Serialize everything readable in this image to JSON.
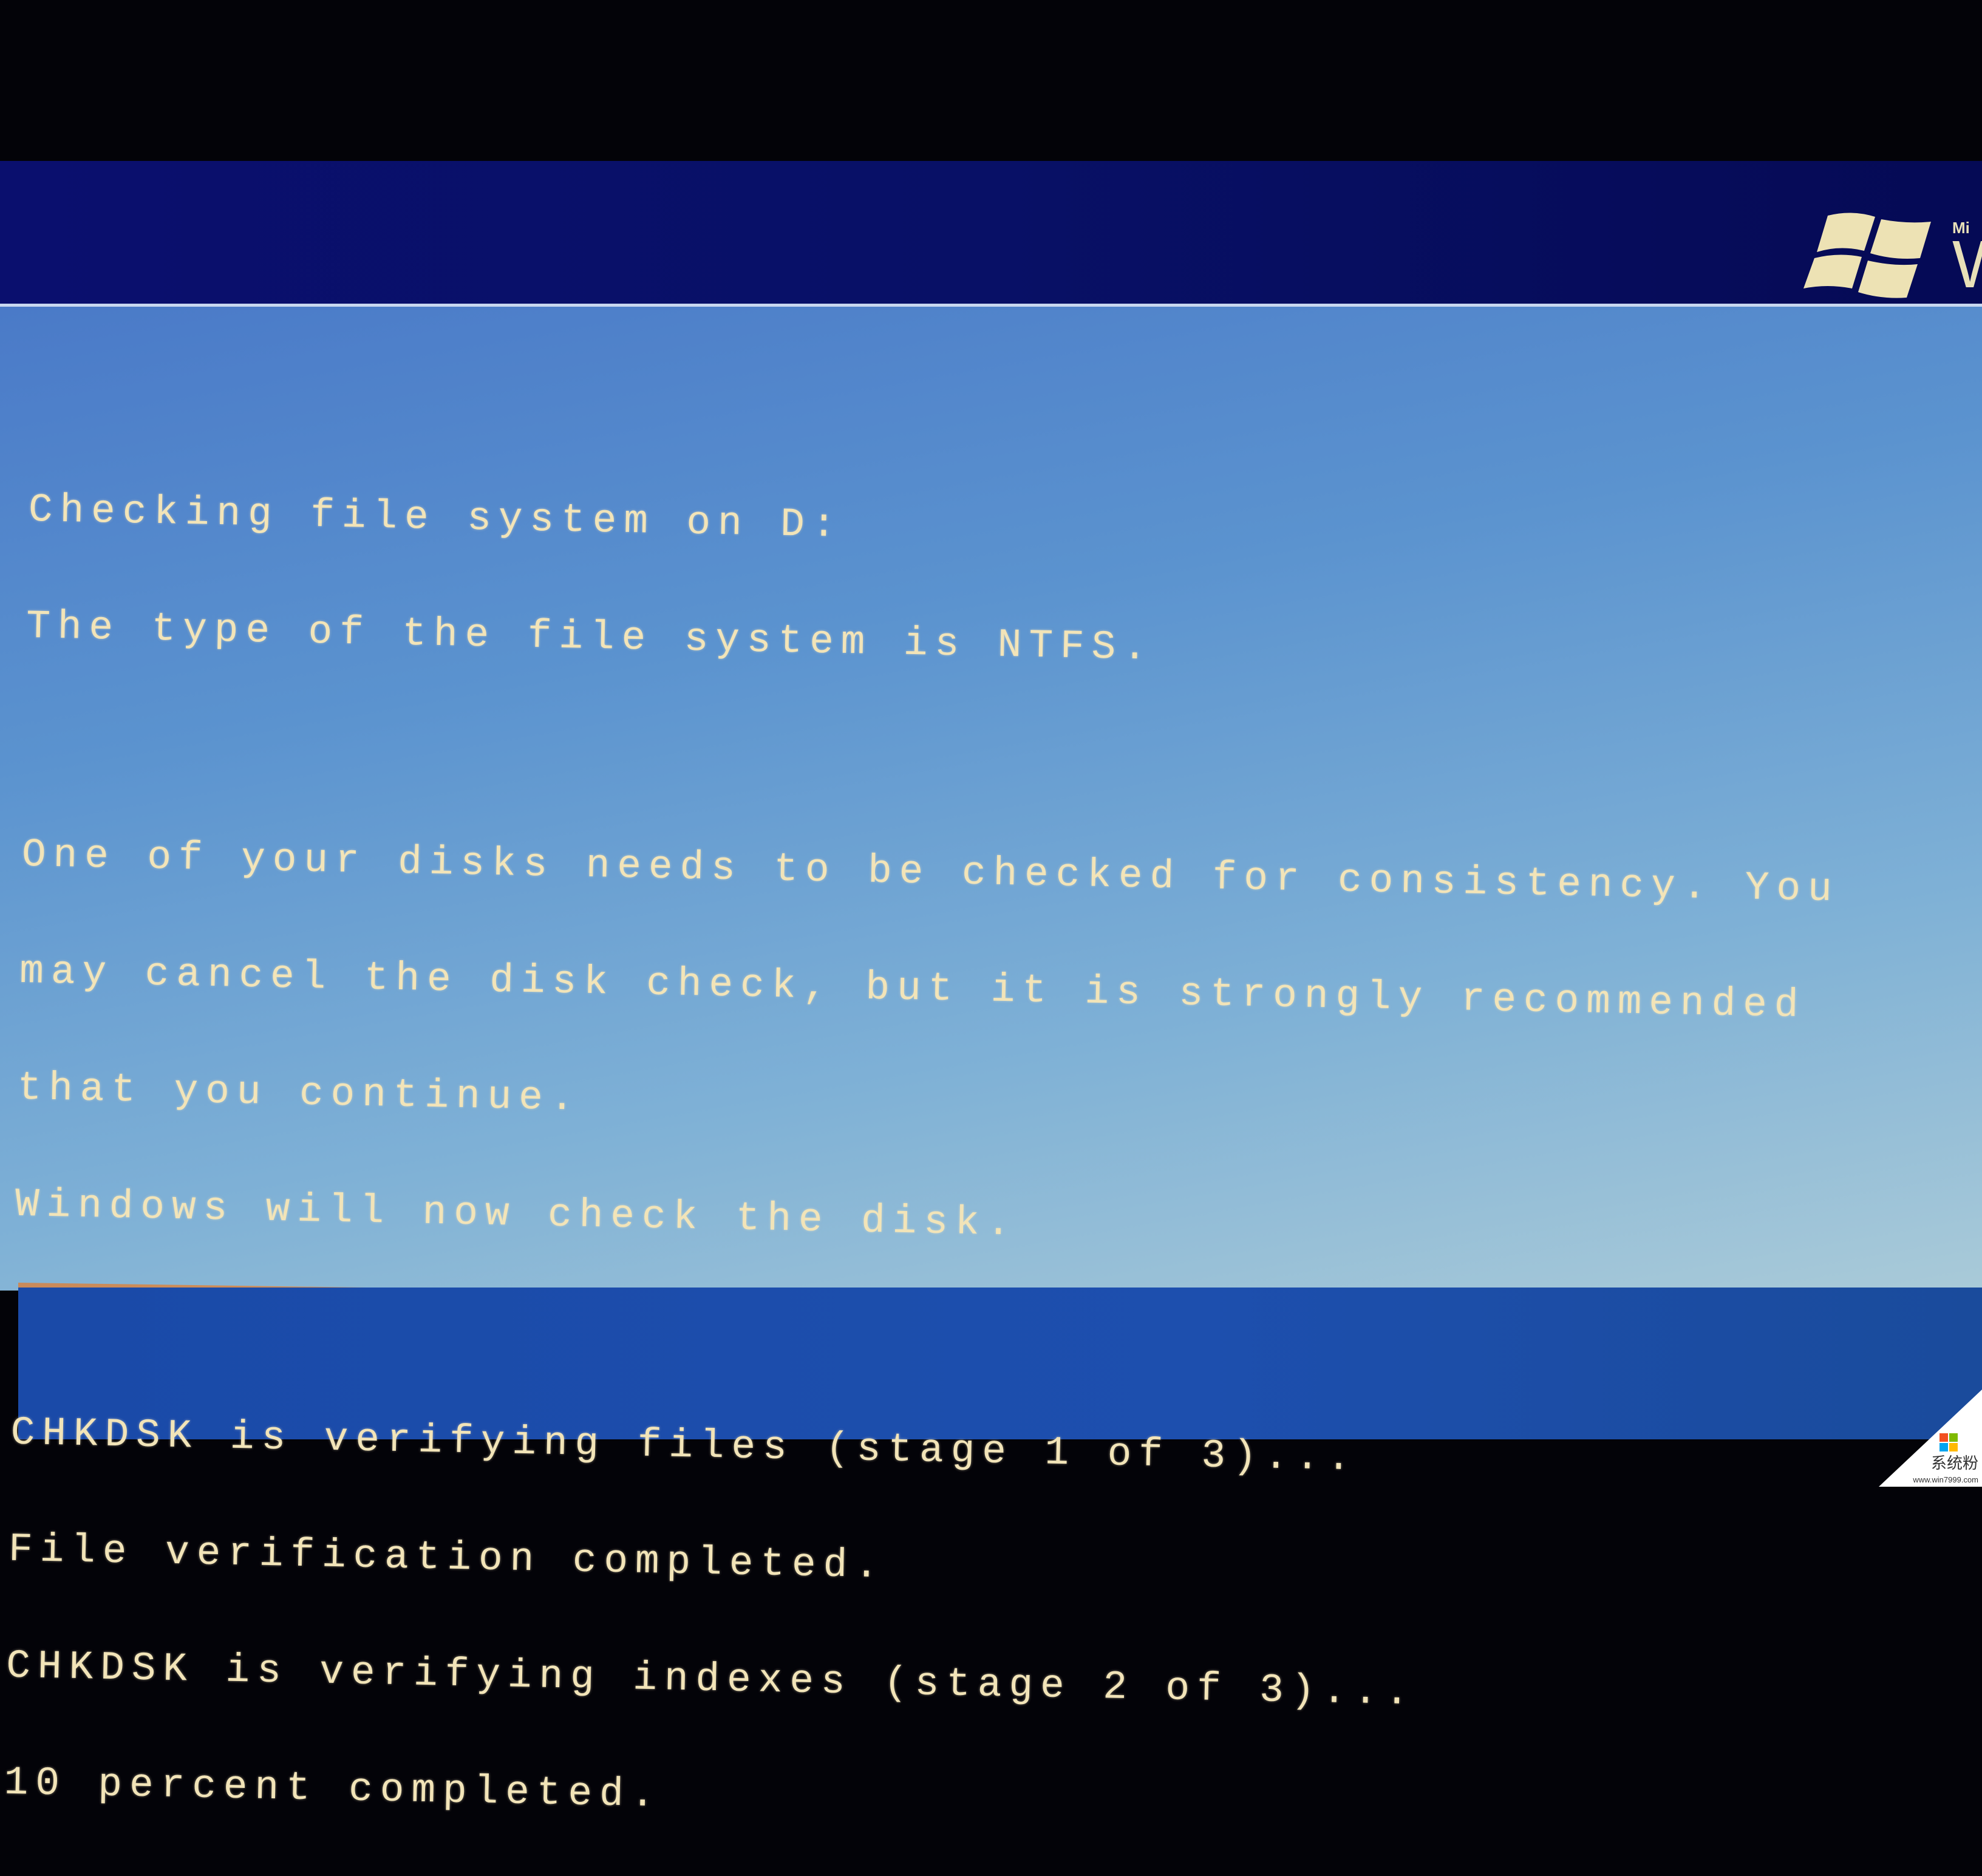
{
  "branding": {
    "logo_small": "Mi",
    "logo_big": "W"
  },
  "console": {
    "lines": [
      "Checking file system on D:",
      "The type of the file system is NTFS.",
      "",
      "One of your disks needs to be checked for consistency. You",
      "may cancel the disk check, but it is strongly recommended",
      "that you continue.",
      "Windows will now check the disk.",
      "",
      "CHKDSK is verifying files (stage 1 of 3)...",
      "File verification completed.",
      "CHKDSK is verifying indexes (stage 2 of 3)...",
      "10 percent completed."
    ]
  },
  "progress": {
    "stage": 2,
    "total_stages": 3,
    "percent": 10
  },
  "watermark": {
    "name": "系统粉",
    "url": "www.win7999.com",
    "colors": [
      "#f25022",
      "#7fba00",
      "#00a4ef",
      "#ffb900"
    ]
  },
  "colors": {
    "background": "#5b93cf",
    "text": "#f2e4b8",
    "accent_line": "#f0a040"
  }
}
